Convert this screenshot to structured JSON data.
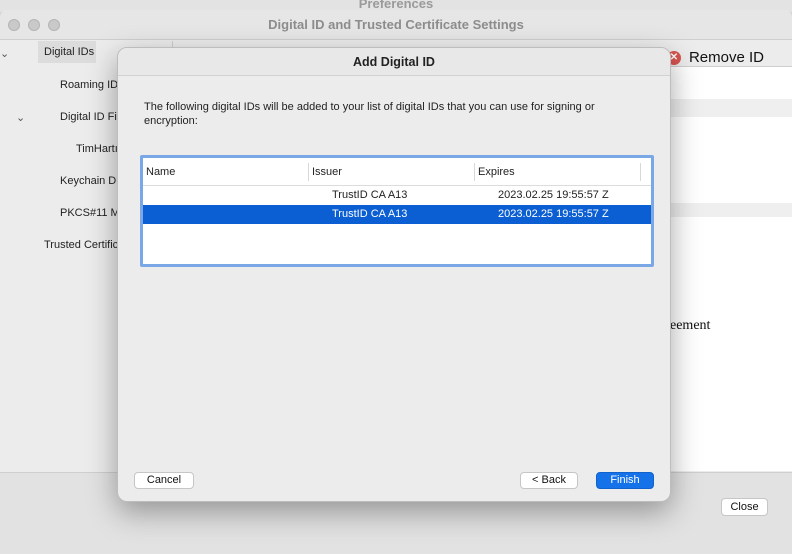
{
  "preferences_window": {
    "title": "Preferences"
  },
  "settings_window": {
    "title": "Digital ID and Trusted Certificate Settings",
    "tree": {
      "digital_ids": "Digital IDs",
      "roaming": "Roaming ID",
      "digital_id_files": "Digital ID Fi",
      "timhart": "TimHartı",
      "keychain": "Keychain Di",
      "pkcs11": "PKCS#11 M",
      "trusted_certs": "Trusted Certific"
    },
    "remove_id": "Remove ID",
    "agreement_text": "eement",
    "close_button": "Close"
  },
  "dialog": {
    "title": "Add Digital ID",
    "message": "The following digital IDs will be added to your list of digital IDs that you can use for signing or encryption:",
    "columns": {
      "name": "Name",
      "issuer": "Issuer",
      "expires": "Expires"
    },
    "rows": [
      {
        "name": "",
        "issuer": "TrustID CA A13",
        "expires": "2023.02.25 19:55:57 Z"
      },
      {
        "name": "",
        "issuer": "TrustID CA A13",
        "expires": "2023.02.25 19:55:57 Z"
      }
    ],
    "buttons": {
      "cancel": "Cancel",
      "back": "< Back",
      "finish": "Finish"
    }
  }
}
